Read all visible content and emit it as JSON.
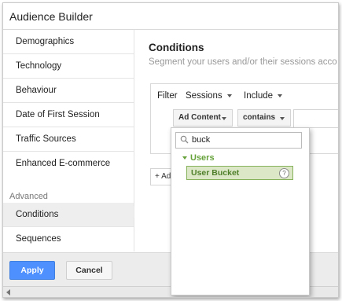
{
  "window": {
    "title": "Audience Builder"
  },
  "sidebar": {
    "items": [
      {
        "label": "Demographics"
      },
      {
        "label": "Technology"
      },
      {
        "label": "Behaviour"
      },
      {
        "label": "Date of First Session"
      },
      {
        "label": "Traffic Sources"
      },
      {
        "label": "Enhanced E-commerce"
      }
    ],
    "advanced_heading": "Advanced",
    "advanced_items": [
      {
        "label": "Conditions",
        "active": true
      },
      {
        "label": "Sequences"
      }
    ]
  },
  "main": {
    "title": "Conditions",
    "subtitle": "Segment your users and/or their sessions acco",
    "filter": {
      "label": "Filter",
      "scope": "Sessions",
      "mode": "Include",
      "dimension": "Ad Content",
      "operator": "contains"
    },
    "add_button": "+ Add"
  },
  "dropdown": {
    "search_value": "buck",
    "group_label": "Users",
    "option_label": "User Bucket",
    "help_glyph": "?"
  },
  "footer": {
    "apply_label": "Apply",
    "cancel_label": "Cancel"
  },
  "colors": {
    "accent": "#4d90fe",
    "group": "#66a23a",
    "option_bg": "#dbe7c6"
  }
}
